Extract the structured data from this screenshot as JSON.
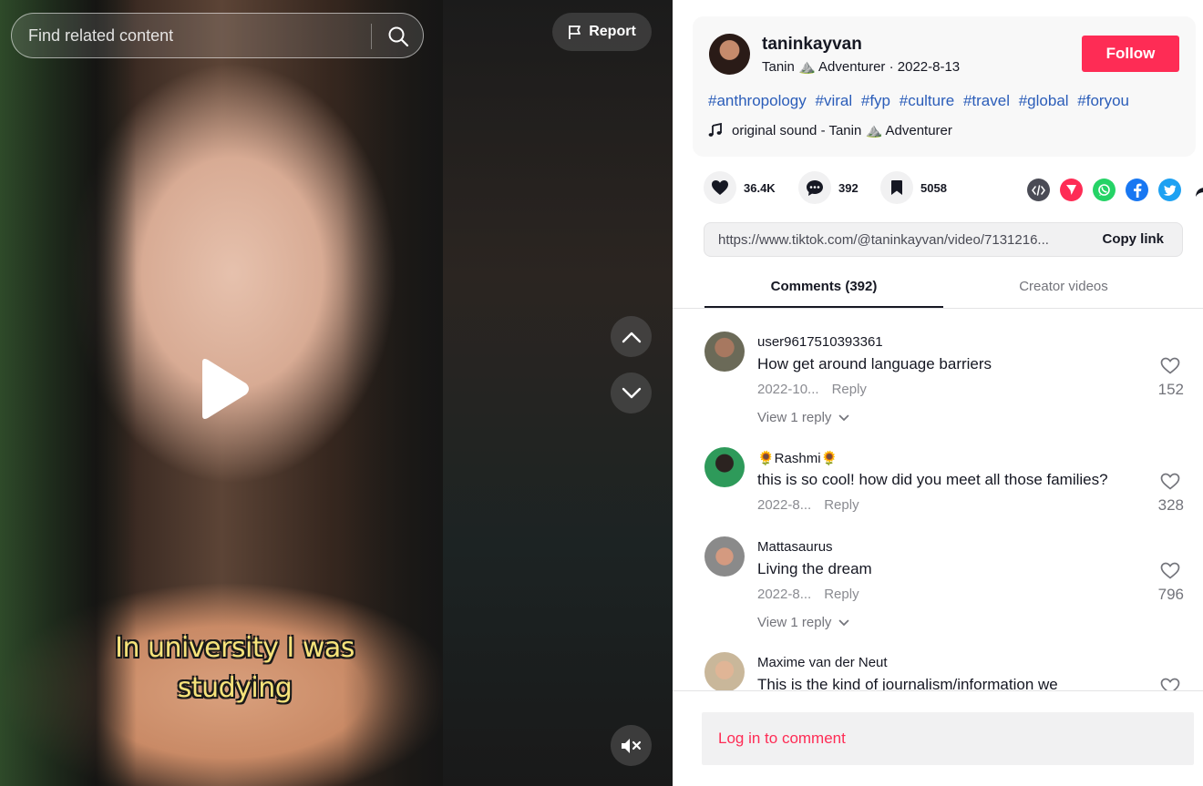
{
  "search": {
    "placeholder": "Find related content"
  },
  "video": {
    "report_label": "Report",
    "caption_line1": "In university I was",
    "caption_line2": "studying"
  },
  "author": {
    "username": "taninkayvan",
    "nickname": "Tanin ⛰️ Adventurer",
    "date": "2022-8-13",
    "sub_separator": " · ",
    "follow_label": "Follow"
  },
  "hashtags": [
    "#anthropology",
    "#viral",
    "#fyp",
    "#culture",
    "#travel",
    "#global",
    "#foryou"
  ],
  "music": {
    "label": "original sound - Tanin ⛰️ Adventurer"
  },
  "stats": {
    "likes": "36.4K",
    "comments": "392",
    "saves": "5058"
  },
  "share_icons": [
    "embed-icon",
    "send-icon",
    "whatsapp-icon",
    "facebook-icon",
    "twitter-icon",
    "share-arrow-icon"
  ],
  "link": {
    "url": "https://www.tiktok.com/@taninkayvan/video/7131216...",
    "copy_label": "Copy link"
  },
  "tabs": [
    {
      "label": "Comments (392)"
    },
    {
      "label": "Creator videos"
    }
  ],
  "comments": [
    {
      "user": "user9617510393361",
      "text": "How get around language barriers",
      "date": "2022-10...",
      "reply": "Reply",
      "likes": "152",
      "view_replies": "View 1 reply"
    },
    {
      "user": "🌻Rashmi🌻",
      "text": "this is so cool! how did you meet all those families?",
      "date": "2022-8...",
      "reply": "Reply",
      "likes": "328"
    },
    {
      "user": "Mattasaurus",
      "text": "Living the dream",
      "date": "2022-8...",
      "reply": "Reply",
      "likes": "796",
      "view_replies": "View 1 reply"
    },
    {
      "user": "Maxime van der Neut",
      "text": "This is the kind of journalism/information we"
    }
  ],
  "login": {
    "label": "Log in to comment"
  },
  "colors": {
    "brand": "#fe2c55",
    "hashtag": "#2b5db9",
    "caption": "#f6e37a"
  }
}
